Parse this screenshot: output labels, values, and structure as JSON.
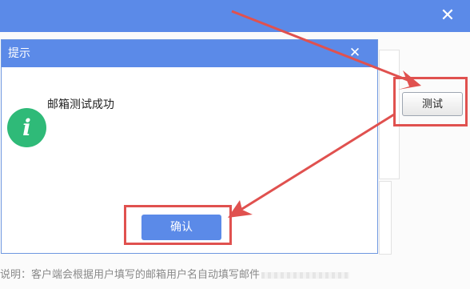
{
  "background": {
    "close_icon": "✕",
    "note_text": "说明：客户端会根据用户填写的邮箱用户名自动填写邮件"
  },
  "test_button": {
    "label": "测试"
  },
  "dialog": {
    "title": "提示",
    "close_icon": "✕",
    "info_icon": "i",
    "message": "邮箱测试成功",
    "confirm_label": "确认"
  },
  "colors": {
    "title_bar": "#5b8ae8",
    "info_icon": "#2fba78",
    "annotation": "#e0514f"
  }
}
